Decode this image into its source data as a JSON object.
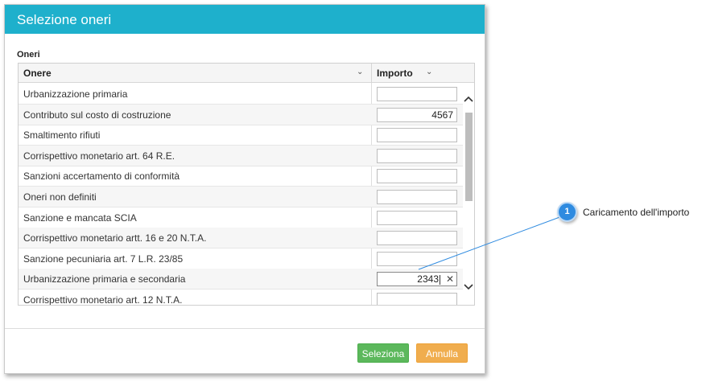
{
  "dialog": {
    "title": "Selezione oneri",
    "section_label": "Oneri",
    "columns": {
      "name": "Onere",
      "amount": "Importo"
    },
    "rows": [
      {
        "name": "Urbanizzazione primaria",
        "amount": ""
      },
      {
        "name": "Contributo sul costo di costruzione",
        "amount": "4567"
      },
      {
        "name": "Smaltimento rifiuti",
        "amount": ""
      },
      {
        "name": "Corrispettivo monetario art. 64 R.E.",
        "amount": ""
      },
      {
        "name": "Sanzioni accertamento di conformità",
        "amount": ""
      },
      {
        "name": "Oneri non definiti",
        "amount": ""
      },
      {
        "name": "Sanzione e mancata SCIA",
        "amount": ""
      },
      {
        "name": "Corrispettivo monetario artt. 16 e 20 N.T.A.",
        "amount": ""
      },
      {
        "name": "Sanzione pecuniaria art. 7 L.R. 23/85",
        "amount": ""
      },
      {
        "name": "Urbanizzazione primaria e secondaria",
        "amount": "2343"
      },
      {
        "name": "Corrispettivo monetario art. 12 N.T.A.",
        "amount": ""
      }
    ],
    "buttons": {
      "ok": "Seleziona",
      "cancel": "Annulla"
    }
  },
  "annotation": {
    "number": "1",
    "text": "Caricamento dell'importo"
  },
  "colors": {
    "header": "#1eb0cc",
    "ok": "#5cb85c",
    "cancel": "#f0ad4e",
    "badge": "#2f8be0"
  }
}
